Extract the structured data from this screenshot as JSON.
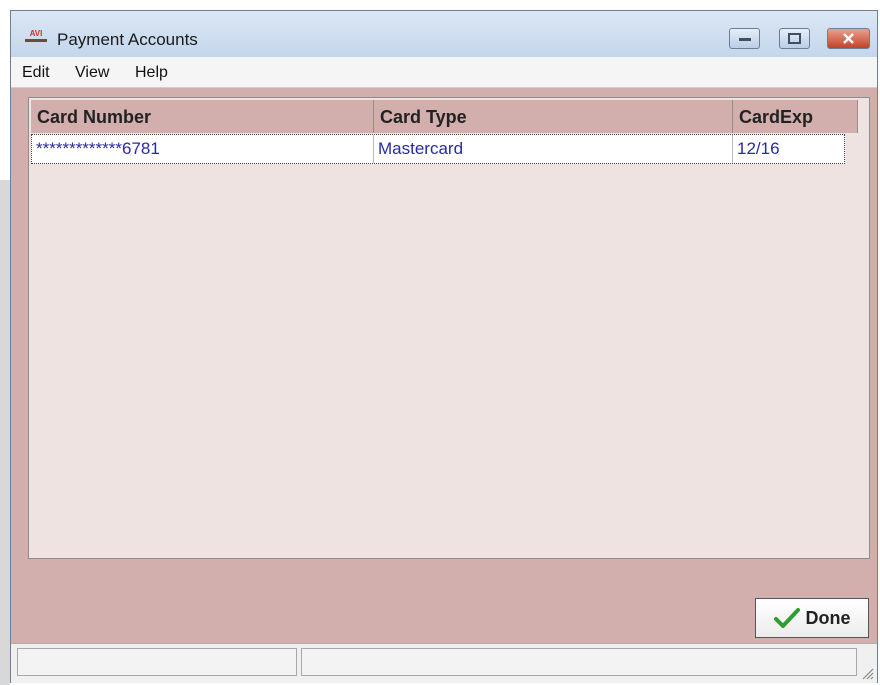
{
  "window": {
    "title": "Payment Accounts",
    "app_icon_text": "AVI"
  },
  "menu": {
    "items": [
      "Edit",
      "View",
      "Help"
    ]
  },
  "table": {
    "columns": [
      "Card Number",
      "Card Type",
      "CardExp"
    ],
    "rows": [
      {
        "card_number": "*************6781",
        "card_type": "Mastercard",
        "card_exp": "12/16"
      }
    ]
  },
  "buttons": {
    "done_label": "Done"
  },
  "colors": {
    "window_bg": "#d2aeac",
    "grid_bg": "#efe3e1",
    "cell_text": "#2a2aa0",
    "check": "#2e9e2e"
  }
}
